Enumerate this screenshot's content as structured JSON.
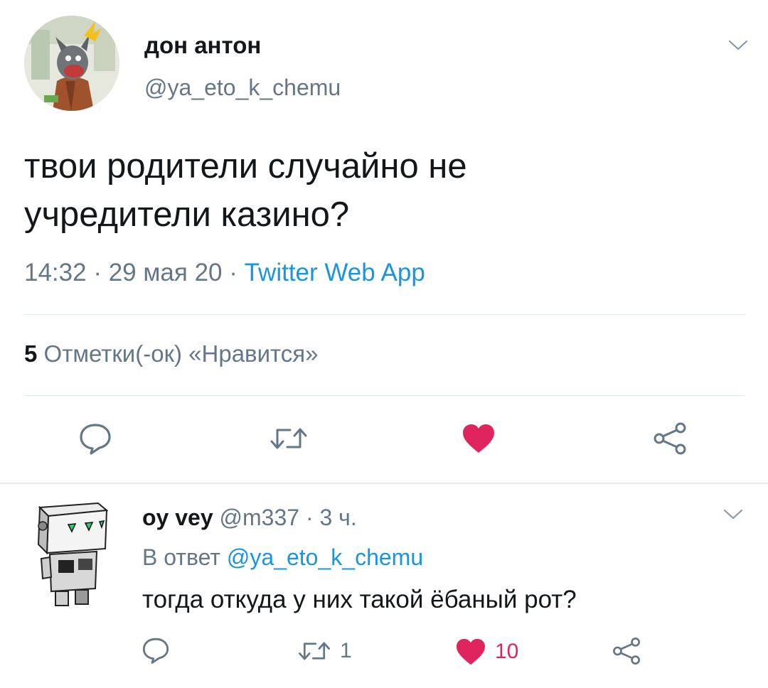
{
  "tweet": {
    "author_name": "дон антон",
    "author_handle": "@ya_eto_k_chemu",
    "text_line1": "твои родители случайно не",
    "text_line2": "учредители казино?",
    "time": "14:32",
    "date": "29 мая 20",
    "source": "Twitter Web App",
    "separator": " · ",
    "likes_count": "5",
    "likes_label": "Отметки(-ок) «Нравится»",
    "actions": {
      "reply_icon": "reply-icon",
      "retweet_icon": "retweet-icon",
      "like_icon": "heart-filled-icon",
      "share_icon": "share-icon"
    }
  },
  "reply": {
    "author_name": "oy vey",
    "author_handle": "@m337",
    "time_ago": "3 ч.",
    "separator": " · ",
    "in_reply_prefix": "В ответ",
    "in_reply_handle": "@ya_eto_k_chemu",
    "text": "тогда откуда у них такой ёбаный рот?",
    "retweet_count": "1",
    "like_count": "10"
  },
  "colors": {
    "accent": "#1b95e0",
    "like": "#e0245e",
    "secondary_text": "#657786",
    "divider": "#e1e8ed"
  }
}
